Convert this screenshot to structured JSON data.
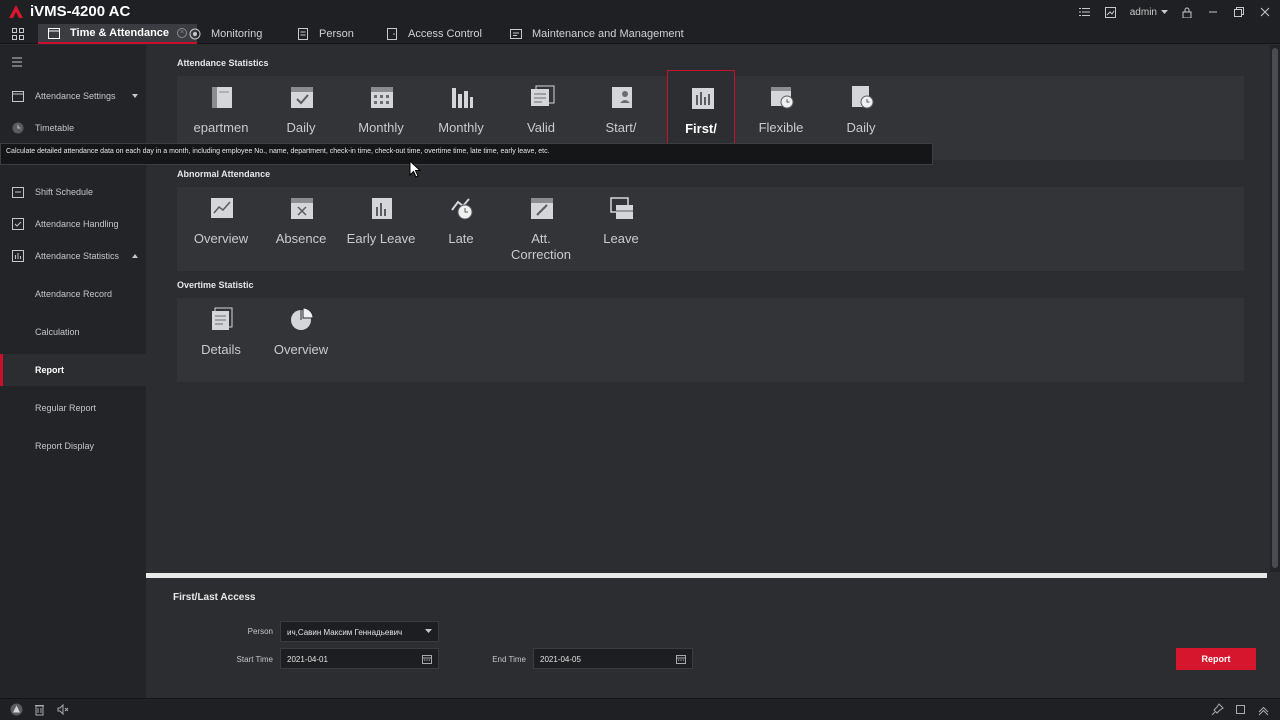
{
  "app": {
    "title": "iVMS-4200 AC",
    "user": "admin"
  },
  "tabs": [
    {
      "label": "Time & Attendance",
      "active": true
    },
    {
      "label": "Monitoring"
    },
    {
      "label": "Person"
    },
    {
      "label": "Access Control"
    },
    {
      "label": "Maintenance and Management"
    }
  ],
  "sidebar": {
    "items": [
      {
        "label": "Attendance Settings",
        "icon": "calendar-icon"
      },
      {
        "label": "Timetable",
        "icon": "clock-icon"
      },
      {
        "label": "Shift Schedule",
        "icon": "schedule-icon"
      },
      {
        "label": "Attendance Handling",
        "icon": "check-icon"
      },
      {
        "label": "Attendance Statistics",
        "icon": "chart-icon"
      },
      {
        "label": "Attendance Record"
      },
      {
        "label": "Calculation"
      },
      {
        "label": "Report"
      },
      {
        "label": "Regular Report"
      },
      {
        "label": "Report Display"
      }
    ]
  },
  "sections": {
    "attendance_statistics": {
      "title": "Attendance Statistics",
      "tiles": [
        "epartmen",
        "Daily",
        "Monthly",
        "Monthly",
        "Valid",
        "Start/",
        "First/",
        "Flexible",
        "Daily"
      ]
    },
    "abnormal_attendance": {
      "title": "Abnormal Attendance",
      "tiles": [
        "Overview",
        "Absence",
        "Early Leave",
        "Late",
        "Att. Correction",
        "Leave"
      ]
    },
    "overtime_statistic": {
      "title": "Overtime Statistic",
      "tiles": [
        "Details",
        "Overview"
      ]
    }
  },
  "tooltip": "Calculate detailed attendance data on each day in a month, including employee No., name, department, check-in time, check-out time, overtime time, late time, early leave, etc.",
  "report_panel": {
    "title": "First/Last Access",
    "person_label": "Person",
    "person_value": "ич,Савин Максим Геннадьевич",
    "start_label": "Start Time",
    "start_value": "2021-04-01",
    "end_label": "End Time",
    "end_value": "2021-04-05",
    "button": "Report"
  },
  "colors": {
    "accent": "#c8102e",
    "button": "#d6162c",
    "background": "#2b2d31",
    "panel": "#323438"
  }
}
